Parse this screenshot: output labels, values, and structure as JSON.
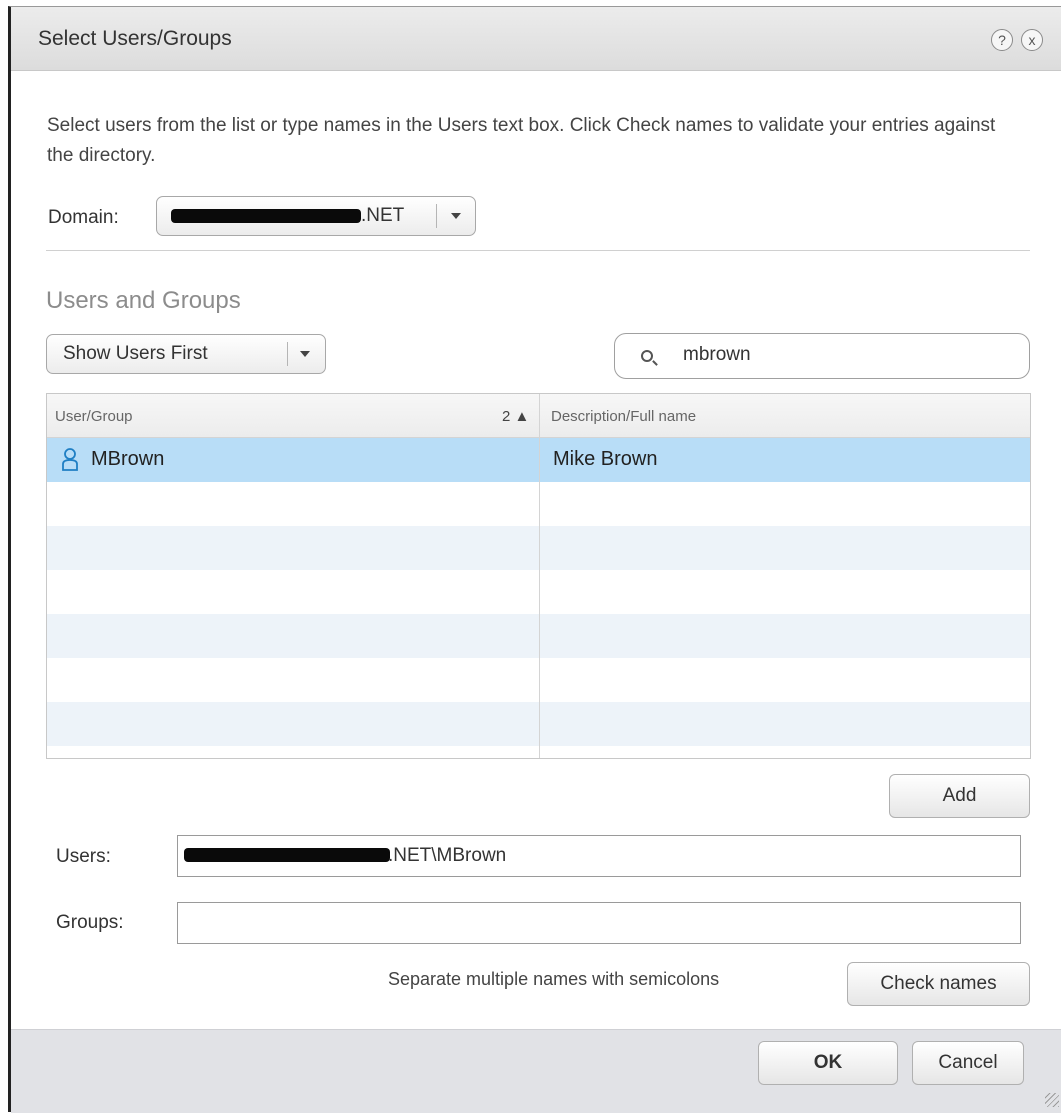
{
  "dialog": {
    "title": "Select Users/Groups",
    "help_glyph": "?",
    "close_glyph": "x",
    "intro": "Select users from the list or type names in the Users text box. Click Check names to validate your entries against the directory."
  },
  "domain": {
    "label": "Domain:",
    "value_suffix": ".NET"
  },
  "users_and_groups": {
    "title": "Users and Groups",
    "filter_select": "Show Users First",
    "search_value": "mbrown",
    "columns": {
      "user_group": "User/Group",
      "sort_indicator": "2 ▲",
      "description": "Description/Full name"
    },
    "rows": [
      {
        "user": "MBrown",
        "description": "Mike Brown",
        "icon": "user-icon",
        "selected": true
      }
    ],
    "add_label": "Add"
  },
  "fields": {
    "users_label": "Users:",
    "users_value_suffix": ".NET\\MBrown",
    "groups_label": "Groups:",
    "groups_value": "",
    "hint": "Separate multiple names with semicolons",
    "check_names_label": "Check names"
  },
  "footer": {
    "ok_label": "OK",
    "cancel_label": "Cancel"
  },
  "colors": {
    "selected_row": "#b8ddf7",
    "alt_row": "#edf3f9",
    "footer_bg": "#e1e2e6",
    "user_icon": "#1f7fc4"
  }
}
